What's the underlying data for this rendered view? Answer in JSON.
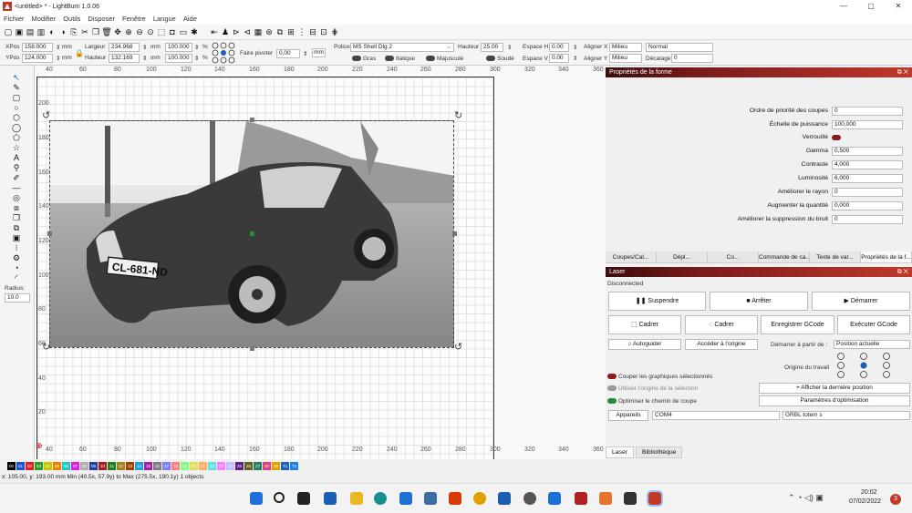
{
  "window": {
    "title": "<untitled> * - LightBurn 1.0.06",
    "controls": [
      "—",
      "▢",
      "✕"
    ]
  },
  "menu": [
    "Fichier",
    "Modifier",
    "Outils",
    "Disposer",
    "Fenêtre",
    "Langue",
    "Aide"
  ],
  "numeric": {
    "xpos_label": "XPos",
    "xpos": "158.000",
    "ypos_label": "YPos",
    "ypos": "124.000",
    "unit": "mm",
    "width_label": "Largeur",
    "width": "234.968",
    "height_label": "Hauteur",
    "height": "132.169",
    "scale_w": "100.000",
    "scale_h": "100.000",
    "pct": "%",
    "rotate_label": "Faire pivoter",
    "rotate": "0,00"
  },
  "font": {
    "font_label": "Police",
    "font_value": "MS Shell Dlg 2",
    "height_label": "Hauteur",
    "height_value": "25.00",
    "hspace_label": "Espace H",
    "hspace": "0.00",
    "vspace_label": "Espace V",
    "vspace": "0.00",
    "alignx_label": "Aligner X",
    "alignx": "Milieu",
    "aligny_label": "Aligner Y",
    "aligny": "Milieu",
    "mode": "Normal",
    "offset_label": "Décalage",
    "offset": "0",
    "bold": "Gras",
    "italic": "Italique",
    "upper": "Majuscule",
    "welded": "Soudé"
  },
  "left_tools": {
    "radius_label": "Radius:",
    "radius_value": "10.0"
  },
  "rulers": {
    "top": [
      "40",
      "60",
      "80",
      "100",
      "120",
      "140",
      "160",
      "180",
      "200",
      "220",
      "240",
      "260",
      "280",
      "300",
      "320",
      "340",
      "360"
    ],
    "bottom": [
      "40",
      "60",
      "80",
      "100",
      "120",
      "140",
      "160",
      "180",
      "200",
      "220",
      "240",
      "260",
      "280",
      "300",
      "320",
      "340",
      "360"
    ],
    "left": [
      "200",
      "180",
      "160",
      "140",
      "120",
      "100",
      "80",
      "60",
      "40",
      "20"
    ]
  },
  "shape_props": {
    "title": "Propriétés de la forme",
    "rows": [
      {
        "label": "Ordre de priorité des coupes",
        "value": "0"
      },
      {
        "label": "Échelle de puissance",
        "value": "100,000"
      },
      {
        "label": "Verrouillé",
        "value": ""
      },
      {
        "label": "Gamma",
        "value": "0,500"
      },
      {
        "label": "Contraste",
        "value": "4,000"
      },
      {
        "label": "Luminosité",
        "value": "6,000"
      },
      {
        "label": "Améliorer le rayon",
        "value": "0"
      },
      {
        "label": "Augmenter la quantité",
        "value": "0,000"
      },
      {
        "label": "Améliorer la suppression du bruit",
        "value": "0"
      }
    ],
    "tabs": [
      "Coupes/Cal...",
      "Dépl...",
      "Co...",
      "Commande de ca...",
      "Texte de var...",
      "Propriétés de la f..."
    ]
  },
  "laser": {
    "title": "Laser",
    "status": "Disconnected",
    "pause": "Suspendre",
    "stop": "Arrêter",
    "start": "Démarrer",
    "frame1": "Cadrer",
    "frame2": "Cadrer",
    "save_gcode": "Enregistrer GCode",
    "run_gcode": "Exécuter GCode",
    "home": "Autoguider",
    "goto_origin": "Accéder à l'origine",
    "start_from_label": "Démarrer à partir de :",
    "start_from": "Position actuelle",
    "job_origin_label": "Origine du travail",
    "cut_selected": "Couper les graphiques sélectionnés",
    "use_selection_origin": "Utiliser l'origine de la sélection",
    "show_last_position": "Afficher la dernière position",
    "optimize": "Optimiser le chemin de coupe",
    "opt_settings": "Paramètres d'optimisation",
    "devices": "Appareils",
    "port": "COM4",
    "device": "GRBL totem s",
    "bottom_tabs": [
      "Laser",
      "Bibliothèque"
    ]
  },
  "palette": [
    {
      "n": "00",
      "c": "#000000"
    },
    {
      "n": "01",
      "c": "#1f4fd8"
    },
    {
      "n": "02",
      "c": "#e02020"
    },
    {
      "n": "03",
      "c": "#20a020"
    },
    {
      "n": "04",
      "c": "#c8c800"
    },
    {
      "n": "05",
      "c": "#f08000"
    },
    {
      "n": "06",
      "c": "#20c8c8"
    },
    {
      "n": "07",
      "c": "#e020e0"
    },
    {
      "n": "08",
      "c": "#b0b0b0"
    },
    {
      "n": "09",
      "c": "#2040a0"
    },
    {
      "n": "10",
      "c": "#a02020"
    },
    {
      "n": "11",
      "c": "#208020"
    },
    {
      "n": "12",
      "c": "#a08020"
    },
    {
      "n": "13",
      "c": "#a04000"
    },
    {
      "n": "14",
      "c": "#20a0e0"
    },
    {
      "n": "15",
      "c": "#a020a0"
    },
    {
      "n": "16",
      "c": "#808080"
    },
    {
      "n": "17",
      "c": "#8080ff"
    },
    {
      "n": "18",
      "c": "#ff8080"
    },
    {
      "n": "19",
      "c": "#80ff80"
    },
    {
      "n": "20",
      "c": "#e0e060"
    },
    {
      "n": "21",
      "c": "#ffb060"
    },
    {
      "n": "22",
      "c": "#60e0e0"
    },
    {
      "n": "23",
      "c": "#ff80ff"
    },
    {
      "n": "24",
      "c": "#c0c0ff"
    },
    {
      "n": "25",
      "c": "#602080"
    },
    {
      "n": "26",
      "c": "#606020"
    },
    {
      "n": "27",
      "c": "#208060"
    },
    {
      "n": "28",
      "c": "#e04080"
    },
    {
      "n": "29",
      "c": "#e0a000"
    },
    {
      "n": "T1",
      "c": "#2060c0"
    },
    {
      "n": "T2",
      "c": "#2080e0"
    }
  ],
  "status": "x: 105.00, y: 193.00 mm   Min (40.5x, 57.9y) to Max (275.5x, 190.1y)   1 objects",
  "taskbar": {
    "time": "20:02",
    "date": "07/02/2022",
    "badge": "3"
  }
}
